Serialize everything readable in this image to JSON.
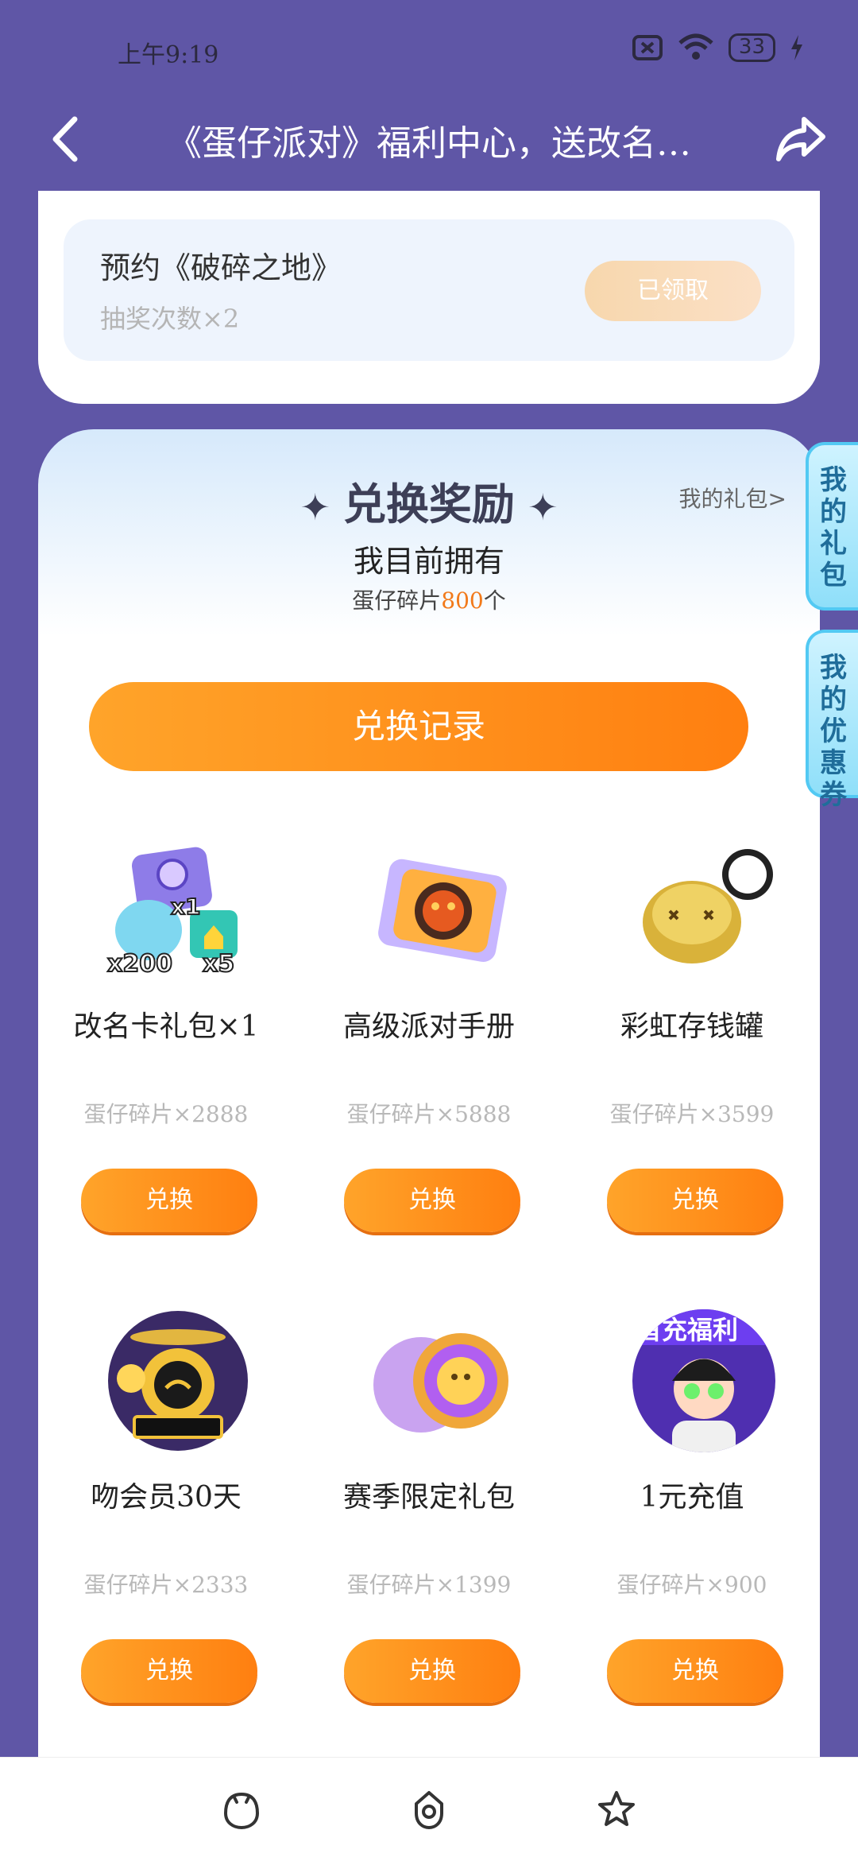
{
  "status": {
    "time": "上午9:19",
    "battery": "33"
  },
  "header": {
    "title": "《蛋仔派对》福利中心，送改名…"
  },
  "task": {
    "title": "预约《破碎之地》",
    "sub": "抽奖次数×2",
    "btn": "已领取"
  },
  "exchange": {
    "title": "兑换奖励",
    "my_gifts": "我的礼包>",
    "own_title": "我目前拥有",
    "own_prefix": "蛋仔碎片",
    "own_count": "800",
    "own_suffix": "个",
    "record_btn": "兑换记录",
    "items": [
      {
        "name": "改名卡礼包×1",
        "price": "蛋仔碎片×2888",
        "btn": "兑换"
      },
      {
        "name": "高级派对手册",
        "price": "蛋仔碎片×5888",
        "btn": "兑换"
      },
      {
        "name": "彩虹存钱罐",
        "price": "蛋仔碎片×3599",
        "btn": "兑换"
      },
      {
        "name": "吻会员30天",
        "price": "蛋仔碎片×2333",
        "btn": "兑换"
      },
      {
        "name": "赛季限定礼包",
        "price": "蛋仔碎片×1399",
        "btn": "兑换"
      },
      {
        "name": "1元充值",
        "price": "蛋仔碎片×900",
        "btn": "兑换"
      }
    ]
  },
  "side_tabs": {
    "gifts": "我的礼包",
    "coupons": "我的优惠券"
  },
  "thumb_text": {
    "x1": "x1",
    "x200": "x200",
    "x5": "x5",
    "banner": "首充福利"
  },
  "icons": [
    "back-arrow-icon",
    "share-icon",
    "wifi-icon",
    "sim-icon",
    "battery-icon",
    "home-icon",
    "game-icon",
    "favorite-icon"
  ]
}
